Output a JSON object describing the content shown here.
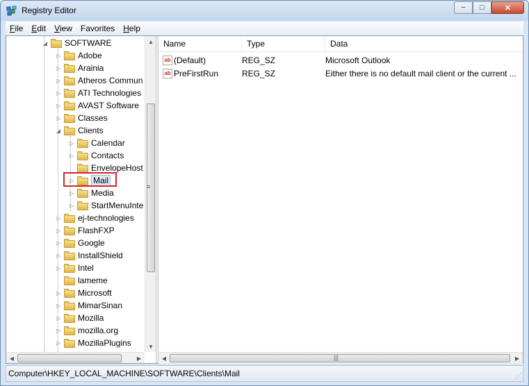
{
  "window": {
    "title": "Registry Editor",
    "minimize": "−",
    "maximize": "□",
    "close": "✕"
  },
  "menu": [
    {
      "key": "F",
      "rest": "ile"
    },
    {
      "key": "E",
      "rest": "dit"
    },
    {
      "key": "V",
      "rest": "iew"
    },
    {
      "key": "F",
      "rest": "avorites",
      "pre": ""
    },
    {
      "key": "H",
      "rest": "elp"
    }
  ],
  "menu_labels": [
    "File",
    "Edit",
    "View",
    "Favorites",
    "Help"
  ],
  "tree": {
    "items": [
      {
        "label": "SOFTWARE",
        "expander": "◢"
      },
      {
        "label": "Adobe",
        "expander": "▷"
      },
      {
        "label": "Arainia",
        "expander": "▷"
      },
      {
        "label": "Atheros Commun",
        "expander": "▷"
      },
      {
        "label": "ATI Technologies",
        "expander": "▷"
      },
      {
        "label": "AVAST Software",
        "expander": "▷"
      },
      {
        "label": "Classes",
        "expander": "▷"
      },
      {
        "label": "Clients",
        "expander": "◢"
      },
      {
        "label": "Calendar",
        "expander": "▷"
      },
      {
        "label": "Contacts",
        "expander": "▷"
      },
      {
        "label": "EnvelopeHost",
        "expander": ""
      },
      {
        "label": "Mail",
        "expander": "▷"
      },
      {
        "label": "Media",
        "expander": "▷"
      },
      {
        "label": "StartMenuInte",
        "expander": "▷"
      },
      {
        "label": "ej-technologies",
        "expander": "▷"
      },
      {
        "label": "FlashFXP",
        "expander": "▷"
      },
      {
        "label": "Google",
        "expander": "▷"
      },
      {
        "label": "InstallShield",
        "expander": "▷"
      },
      {
        "label": "Intel",
        "expander": "▷"
      },
      {
        "label": "lameme",
        "expander": ""
      },
      {
        "label": "Microsoft",
        "expander": "▷"
      },
      {
        "label": "MimarSinan",
        "expander": "▷"
      },
      {
        "label": "Mozilla",
        "expander": "▷"
      },
      {
        "label": "mozilla.org",
        "expander": "▷"
      },
      {
        "label": "MozillaPlugins",
        "expander": "▷"
      }
    ]
  },
  "list": {
    "columns": [
      "Name",
      "Type",
      "Data"
    ],
    "rows": [
      {
        "icon": "ab",
        "name": "(Default)",
        "type": "REG_SZ",
        "data": "Microsoft Outlook"
      },
      {
        "icon": "ab",
        "name": "PreFirstRun",
        "type": "REG_SZ",
        "data": "Either there is no default mail client or the current ..."
      }
    ]
  },
  "status": {
    "path": "Computer\\HKEY_LOCAL_MACHINE\\SOFTWARE\\Clients\\Mail"
  },
  "scroll": {
    "up": "▲",
    "down": "▼",
    "left": "◀",
    "right": "▶",
    "grip": "≡",
    "hgrip": "|||"
  },
  "colors": {
    "highlight_border": "#d0262b",
    "selection_bg": "#dde9f7"
  },
  "icons": {
    "app": "registry-editor-icon",
    "value": "string-value-icon",
    "folder": "folder-icon"
  }
}
